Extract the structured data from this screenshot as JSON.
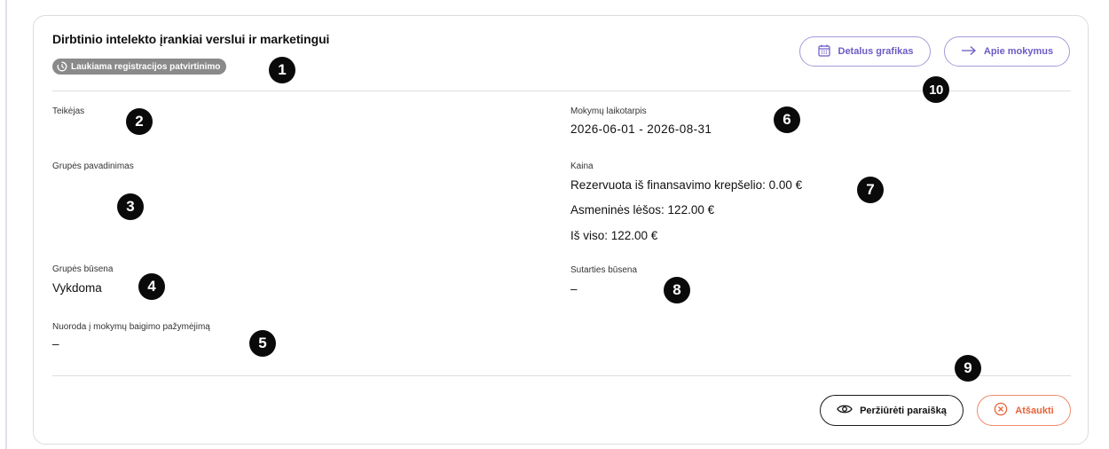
{
  "course": {
    "title": "Dirbtinio intelekto įrankiai verslui ir marketingui",
    "status_badge": "Laukiama registracijos patvirtinimo"
  },
  "header_buttons": {
    "schedule_label": "Detalus grafikas",
    "about_label": "Apie mokymus"
  },
  "fields": {
    "provider_label": "Teikėjas",
    "provider_value": "",
    "group_name_label": "Grupės pavadinimas",
    "group_name_value": "",
    "group_status_label": "Grupės būsena",
    "group_status_value": "Vykdoma",
    "certificate_link_label": "Nuoroda į mokymų baigimo pažymėjimą",
    "certificate_link_value": "–",
    "period_label": "Mokymų laikotarpis",
    "period_value": "2026-06-01 - 2026-08-31",
    "price_label": "Kaina",
    "price_reserved": "Rezervuota iš finansavimo krepšelio: 0.00 €",
    "price_personal": "Asmeninės lėšos: 122.00 €",
    "price_total": "Iš viso: 122.00 €",
    "contract_status_label": "Sutarties būsena",
    "contract_status_value": "–"
  },
  "footer_buttons": {
    "view_application_label": "Peržiūrėti paraišką",
    "cancel_label": "Atšaukti"
  },
  "markers": [
    "1",
    "2",
    "3",
    "4",
    "5",
    "6",
    "7",
    "8",
    "9",
    "10"
  ],
  "colors": {
    "accent_purple": "#6b5bc4",
    "accent_orange": "#e8633a",
    "badge_gray": "#8a8a8a"
  },
  "icons": {
    "badge": "clock-pending-icon",
    "schedule": "calendar-icon",
    "about": "arrow-right-icon",
    "view": "eye-icon",
    "cancel": "x-circle-icon"
  }
}
